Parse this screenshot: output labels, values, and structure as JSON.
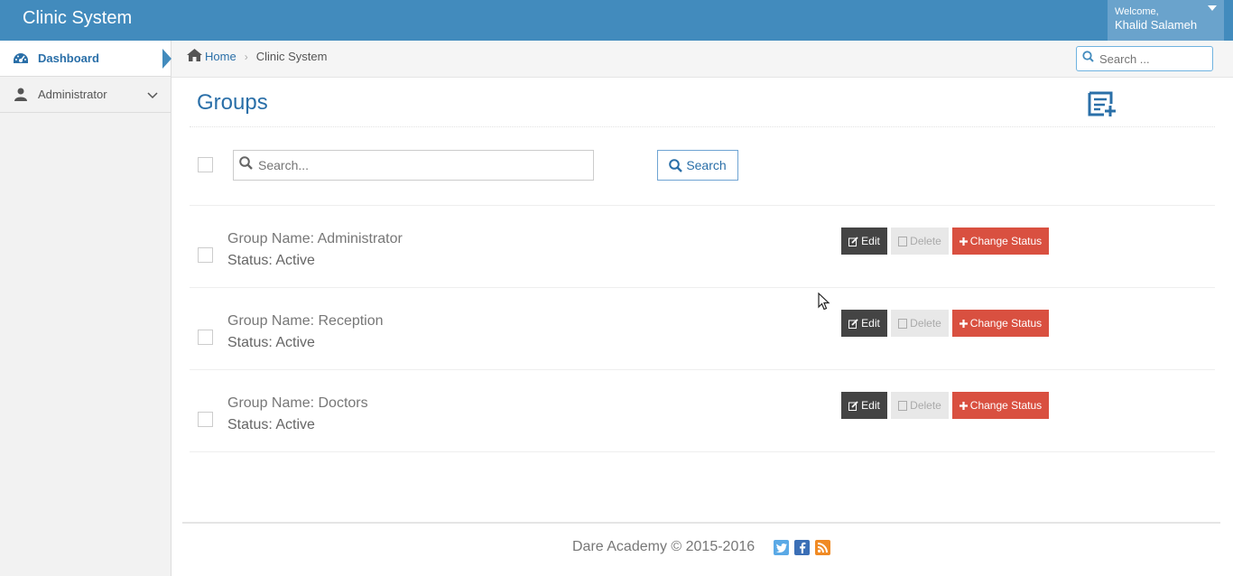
{
  "app": {
    "title": "Clinic System"
  },
  "user": {
    "welcome": "Welcome,",
    "name": "Khalid Salameh"
  },
  "sidebar": {
    "items": [
      {
        "label": "Dashboard",
        "icon": "dashboard-icon",
        "active": true
      },
      {
        "label": "Administrator",
        "icon": "user-icon",
        "active": false
      }
    ]
  },
  "breadcrumb": {
    "home": "Home",
    "current": "Clinic System"
  },
  "top_search": {
    "placeholder": "Search ..."
  },
  "page": {
    "title": "Groups"
  },
  "list_search": {
    "placeholder": "Search...",
    "button": "Search"
  },
  "groups": [
    {
      "name": "Group Name: Administrator",
      "status": "Status: Active"
    },
    {
      "name": "Group Name: Reception",
      "status": "Status: Active"
    },
    {
      "name": "Group Name: Doctors",
      "status": "Status: Active"
    }
  ],
  "actions": {
    "edit": "Edit",
    "delete": "Delete",
    "change_status": "Change Status"
  },
  "footer": {
    "text": "Dare Academy © 2015-2016"
  },
  "colors": {
    "brand": "#428bbd",
    "accent": "#2a6fa8",
    "danger": "#d95040",
    "dark": "#444444",
    "twitter": "#5aa9e6",
    "facebook": "#3b6fb6",
    "rss": "#f08a24"
  }
}
